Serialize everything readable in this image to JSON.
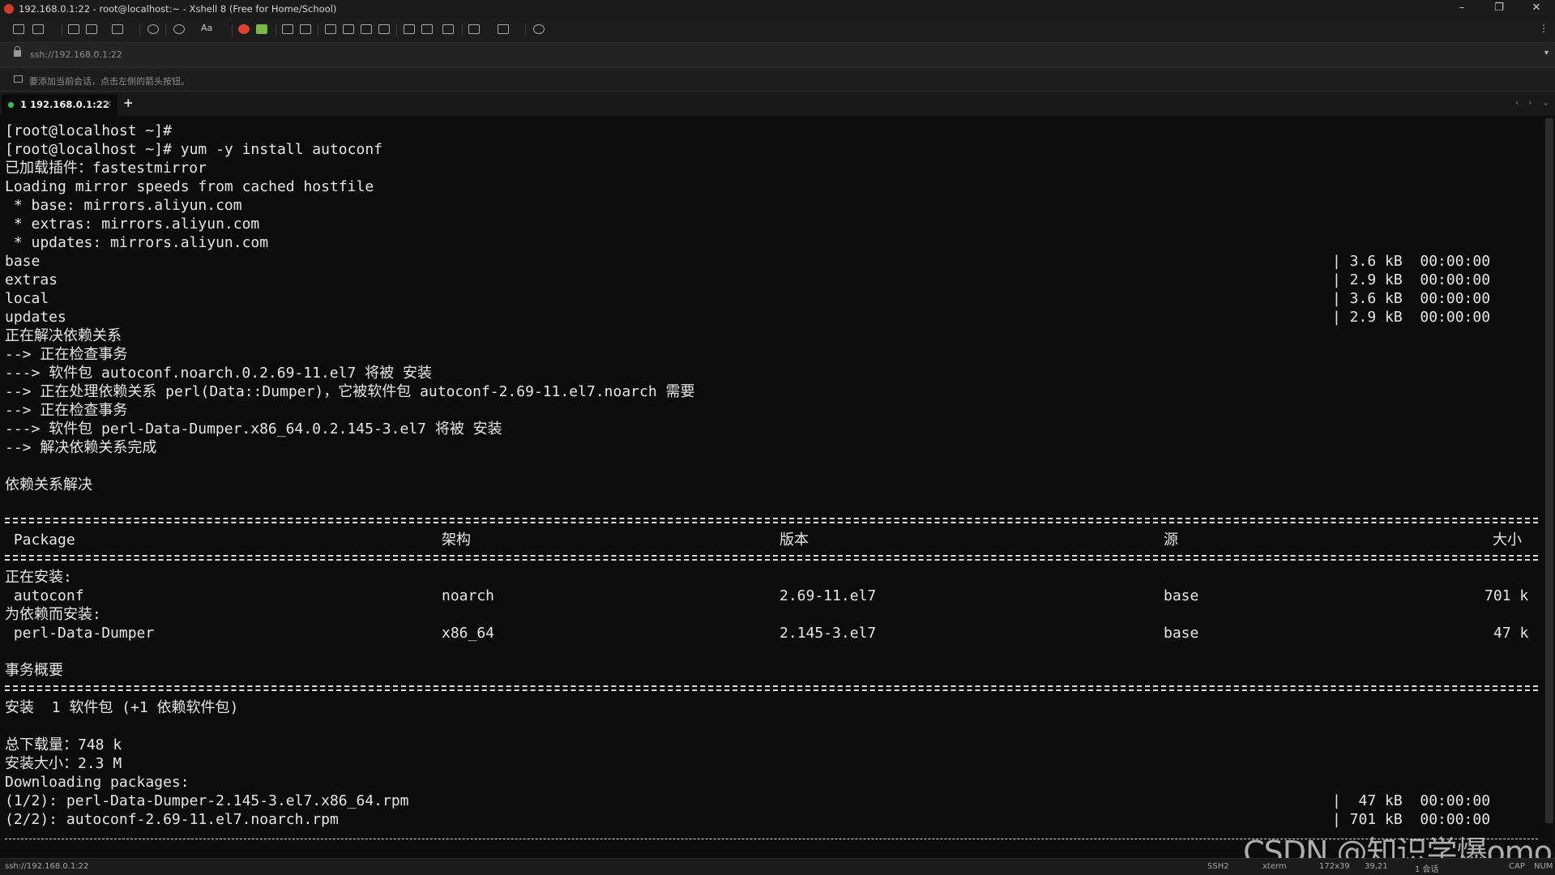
{
  "window": {
    "title": "192.168.0.1:22 - root@localhost:~ - Xshell 8 (Free for Home/School)",
    "minimize": "–",
    "restore": "❐",
    "close": "✕"
  },
  "toolbar": {
    "font_label": "Aa",
    "more": "⋮"
  },
  "address": {
    "text": "ssh://192.168.0.1:22",
    "dropdown": "▾"
  },
  "hint": {
    "text": "要添加当前会话，点击左侧的箭头按钮。"
  },
  "tabs": [
    {
      "number": "1",
      "label": "1 192.168.0.1:22",
      "close": "×",
      "status_color": "#38c24a"
    }
  ],
  "tab_add": "+",
  "terminal": {
    "lines": [
      "[root@localhost ~]#",
      "[root@localhost ~]# yum -y install autoconf",
      "已加载插件：fastestmirror",
      "Loading mirror speeds from cached hostfile",
      " * base: mirrors.aliyun.com",
      " * extras: mirrors.aliyun.com",
      " * updates: mirrors.aliyun.com"
    ],
    "repo_rows": [
      {
        "name": "base",
        "size": "| 3.6 kB  00:00:00"
      },
      {
        "name": "extras",
        "size": "| 2.9 kB  00:00:00"
      },
      {
        "name": "local",
        "size": "| 3.6 kB  00:00:00"
      },
      {
        "name": "updates",
        "size": "| 2.9 kB  00:00:00"
      }
    ],
    "resolve_lines": [
      "正在解决依赖关系",
      "--> 正在检查事务",
      "---> 软件包 autoconf.noarch.0.2.69-11.el7 将被 安装",
      "--> 正在处理依赖关系 perl(Data::Dumper)，它被软件包 autoconf-2.69-11.el7.noarch 需要",
      "--> 正在检查事务",
      "---> 软件包 perl-Data-Dumper.x86_64.0.2.145-3.el7 将被 安装",
      "--> 解决依赖关系完成"
    ],
    "resolved": "依赖关系解决",
    "table_headers": {
      "package": " Package",
      "arch": "架构",
      "version": "版本",
      "repo": "源",
      "size": "大小"
    },
    "installing_label": "正在安装:",
    "dep_label": "为依赖而安装:",
    "packages": [
      {
        "name": " autoconf",
        "arch": "noarch",
        "version": "2.69-11.el7",
        "repo": "base",
        "size": "701 k"
      },
      {
        "name": " perl-Data-Dumper",
        "arch": "x86_64",
        "version": "2.145-3.el7",
        "repo": "base",
        "size": "47 k"
      }
    ],
    "summary_title": "事务概要",
    "install_summary": "安装  1 软件包 (+1 依赖软件包)",
    "total_download": "总下载量：748 k",
    "installed_size": "安装大小：2.3 M",
    "downloading": "Downloading packages:",
    "downloads": [
      {
        "name": "(1/2): perl-Data-Dumper-2.145-3.el7.x86_64.rpm",
        "info": "|  47 kB  00:00:00"
      },
      {
        "name": "(2/2): autoconf-2.69-11.el7.noarch.rpm",
        "info": "| 701 kB  00:00:00"
      }
    ]
  },
  "status": {
    "address": "ssh://192.168.0.1:22",
    "protocol": "SSH2",
    "term": "xterm",
    "size": "172x39",
    "cursor": "39,21",
    "sessions": "1 会话",
    "cap": "CAP",
    "num": "NUM"
  },
  "watermark": "CSDN @知识学爆omo"
}
